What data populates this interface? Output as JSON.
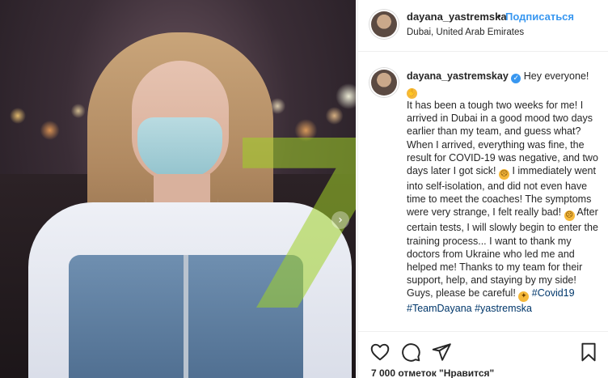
{
  "header": {
    "username": "dayana_yastremska",
    "dot": "•",
    "follow_label": "Подписаться",
    "location": "Dubai, United Arab Emirates"
  },
  "photo": {
    "next_arrow": "›",
    "watermark_color": "#a0d228"
  },
  "caption": {
    "username": "dayana_yastremskay",
    "verified_glyph": "✓",
    "greeting": "Hey everyone!",
    "emoji_wave": "wave-emoji",
    "body_1": "It has been a tough two weeks for me! I arrived in Dubai in a good mood two days earlier than my team, and guess what? When I arrived, everything was fine, the result for COVID-19 was negative, and two days later I got sick!",
    "emoji_sad": "sad-emoji",
    "body_2": "I immediately went into self-isolation, and did not even have time to meet the coaches! The symptoms were very strange, I felt really bad!",
    "emoji_disappointed": "disappointed-emoji",
    "body_3": "After certain tests, I will slowly begin to enter the training process... I want to thank my doctors from Ukraine who led me and helped me! Thanks to my team for their support, help, and staying by my side! Guys, please be careful!",
    "emoji_pray": "pray-emoji",
    "hashtag_1": "#Covid19",
    "hashtag_2": "#TeamDayana",
    "hashtag_3": "#yastremska"
  },
  "actions": {
    "like_icon": "heart-icon",
    "comment_icon": "comment-icon",
    "share_icon": "share-icon",
    "save_icon": "bookmark-icon",
    "likes_text": "7 000 отметок \"Нравится\""
  },
  "colors": {
    "link_blue": "#3897f0",
    "hashtag": "#00376b",
    "text": "#262626"
  }
}
